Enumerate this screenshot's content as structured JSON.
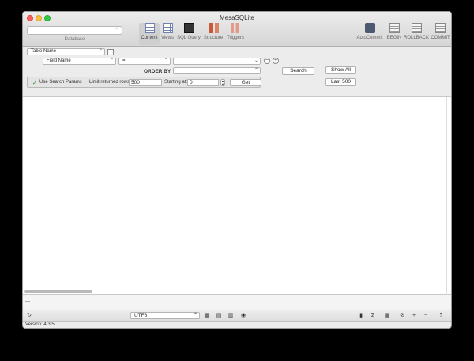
{
  "window": {
    "title": "MesaSQLite"
  },
  "database": {
    "label": "Database",
    "selected": ""
  },
  "toolbar": {
    "tabs": [
      {
        "label": "Content",
        "icon": "content-grid-icon"
      },
      {
        "label": "Views",
        "icon": "views-grid-icon"
      },
      {
        "label": "SQL Query",
        "icon": "sql-query-icon"
      },
      {
        "label": "Structure",
        "icon": "structure-icon"
      },
      {
        "label": "Triggers",
        "icon": "triggers-icon"
      }
    ],
    "actions": [
      {
        "label": "AutoCommit",
        "icon": "autocommit-icon"
      },
      {
        "label": "BEGIN",
        "icon": "begin-icon"
      },
      {
        "label": "ROLLBACK",
        "icon": "rollback-icon"
      },
      {
        "label": "COMMIT",
        "icon": "commit-icon"
      }
    ]
  },
  "filter": {
    "table_name": "Table Name",
    "field_name": "Field Name",
    "operator": "=",
    "value": "",
    "order_by_label": "ORDER BY",
    "order_by_value": "",
    "search_label": "Search",
    "show_all_label": "Show All",
    "last500_label": "Last 500",
    "use_search_params": "Use Search Params",
    "limit_label": "Limit returned rows:",
    "limit_value": "500",
    "starting_label": "Starting at:",
    "starting_value": "0",
    "get_label": "Get",
    "minus": "−",
    "plus": "+"
  },
  "bottombar": {
    "encoding": "UTF8",
    "refresh": "↻"
  },
  "empty_bar": {
    "text": "—"
  },
  "status": {
    "version": "Version: 4.3.5"
  }
}
